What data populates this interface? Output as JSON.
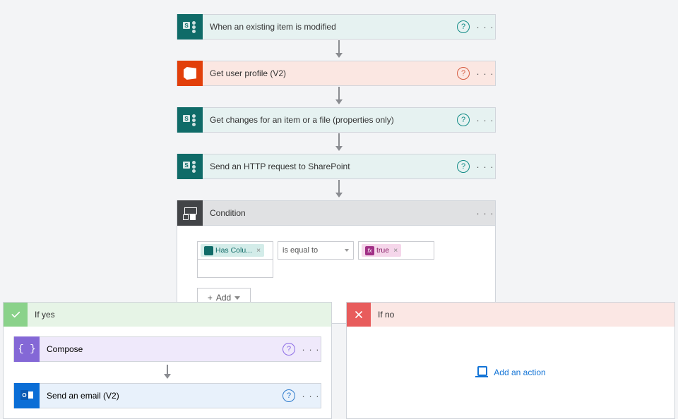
{
  "steps": {
    "trigger": {
      "title": "When an existing item is modified"
    },
    "getUser": {
      "title": "Get user profile (V2)"
    },
    "getChanges": {
      "title": "Get changes for an item or a file (properties only)"
    },
    "httpReq": {
      "title": "Send an HTTP request to SharePoint"
    },
    "condition": {
      "title": "Condition"
    },
    "compose": {
      "title": "Compose"
    },
    "sendEmail": {
      "title": "Send an email (V2)"
    }
  },
  "condition": {
    "leftToken": "Has Colu...",
    "operator": "is equal to",
    "rightToken": "true",
    "fxLabel": "fx",
    "addLabel": "Add"
  },
  "branches": {
    "yesLabel": "If yes",
    "noLabel": "If no",
    "addActionLabel": "Add an action"
  },
  "icons": {
    "help": "?",
    "menu": "· · ·",
    "plus": "+",
    "close": "×"
  }
}
